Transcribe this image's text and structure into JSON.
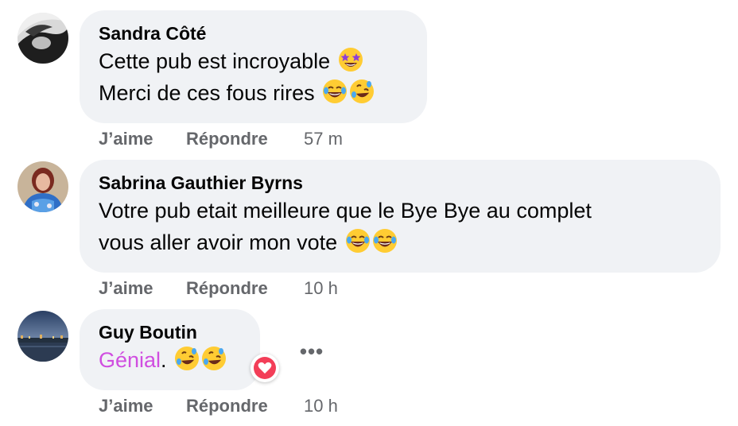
{
  "comments": [
    {
      "author": "Sandra Côté",
      "lines": [
        "Cette pub est incroyable",
        "Merci de ces fous rires"
      ],
      "emojis": [
        "star-struck",
        "joy",
        "rofl"
      ],
      "actions": {
        "like": "J’aime",
        "reply": "Répondre",
        "time": "57 m"
      }
    },
    {
      "author": "Sabrina Gauthier Byrns",
      "lines": [
        "Votre pub etait meilleure que le Bye Bye au complet",
        "vous aller avoir mon vote"
      ],
      "emojis": [
        "joy",
        "joy"
      ],
      "actions": {
        "like": "J’aime",
        "reply": "Répondre",
        "time": "10 h"
      }
    },
    {
      "author": "Guy Boutin",
      "highlight": "Génial",
      "tail": ".",
      "emojis": [
        "rofl",
        "rofl"
      ],
      "reaction": "love",
      "more": "•••",
      "actions": {
        "like": "J’aime",
        "reply": "Répondre",
        "time": "10 h"
      }
    }
  ],
  "colors": {
    "bubble": "#f0f2f5",
    "text": "#050505",
    "secondary": "#65676b",
    "highlight": "#d04ee0",
    "love": "#f33e58"
  }
}
